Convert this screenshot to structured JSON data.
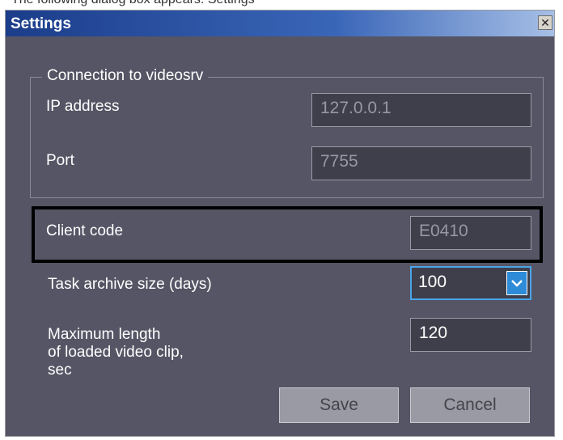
{
  "caption_fragment": "The following dialog box appears: Settings",
  "window": {
    "title": "Settings",
    "close_glyph": "✕"
  },
  "connection_group": {
    "legend": "Connection to videosrv",
    "ip_label": "IP address",
    "ip_value": "127.0.0.1",
    "port_label": "Port",
    "port_value": "7755"
  },
  "client": {
    "label": "Client code",
    "value": "E0410"
  },
  "archive": {
    "label": "Task archive size (days)",
    "value": "100"
  },
  "clip": {
    "label_line1": "Maximum length",
    "label_line2": "of loaded video clip,",
    "label_line3": "sec",
    "value": "120"
  },
  "buttons": {
    "save": "Save",
    "cancel": "Cancel"
  },
  "colors": {
    "background": "#555565",
    "titlebar": "#1b3d8a",
    "accent": "#2d8bd7",
    "highlight": "#000000"
  }
}
